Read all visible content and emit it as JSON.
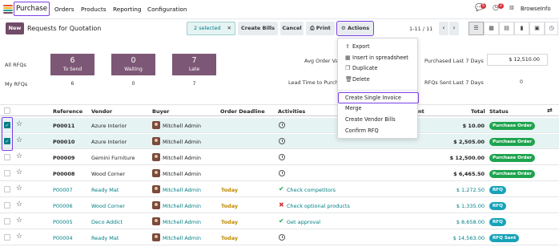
{
  "nav": {
    "app": "Purchase",
    "items": [
      "Orders",
      "Products",
      "Reporting",
      "Configuration"
    ],
    "chat_badge": "5",
    "activity_badge": "2",
    "company": "BrowseInfo"
  },
  "control": {
    "new_label": "New",
    "title": "Requests for Quotation",
    "selected_label": "2 selected",
    "clear_symbol": "✕",
    "create_bills": "Create Bills",
    "cancel": "Cancel",
    "print": "Print",
    "actions": "Actions",
    "pager": "1-11 / 11",
    "prev": "‹",
    "next": "›"
  },
  "dashboard": {
    "all_rfqs_label": "All RFQs",
    "my_rfqs_label": "My RFQs",
    "tiles": [
      {
        "value": "6",
        "label": "To Send"
      },
      {
        "value": "0",
        "label": "Waiting"
      },
      {
        "value": "7",
        "label": "Late"
      }
    ],
    "my_values": [
      "6",
      "0",
      "7"
    ],
    "avg_order_label": "Avg Order Va",
    "lead_time_label": "Lead Time to Purch",
    "purchased_label": "Purchased Last 7 Days",
    "purchased_value": "$ 12,510.00",
    "rfqs_sent_label": "RFQs Sent Last 7 Days",
    "rfqs_sent_value": "0"
  },
  "actions_menu": {
    "items": [
      "Export",
      "Insert in spreadsheet",
      "Duplicate",
      "Delete"
    ],
    "items2": [
      "Create Single Invoice",
      "Merge",
      "Create Vendor Bills",
      "Confirm RFQ"
    ]
  },
  "table": {
    "headers": {
      "reference": "Reference",
      "vendor": "Vendor",
      "buyer": "Buyer",
      "deadline": "Order Deadline",
      "activities": "Activities",
      "partial": "nt",
      "total": "Total",
      "status": "Status"
    },
    "rows": [
      {
        "ref": "P00011",
        "vendor": "Azure Interior",
        "buyer": "Mitchell Admin",
        "deadline": "",
        "activity": "",
        "activity_kind": "clock",
        "total": "$ 10.00",
        "status": "Purchase Order",
        "status_kind": "po",
        "selected": true,
        "style": "bold"
      },
      {
        "ref": "P00010",
        "vendor": "Azure Interior",
        "buyer": "Mitchell Admin",
        "deadline": "",
        "activity": "",
        "activity_kind": "clock",
        "total": "$ 2,505.00",
        "status": "Purchase Order",
        "status_kind": "po",
        "selected": true,
        "style": "bold"
      },
      {
        "ref": "P00009",
        "vendor": "Gemini Furniture",
        "buyer": "Mitchell Admin",
        "deadline": "",
        "activity": "",
        "activity_kind": "clock",
        "total": "$ 12,500.00",
        "status": "Purchase Order",
        "status_kind": "po",
        "selected": false,
        "style": "normal"
      },
      {
        "ref": "P00008",
        "vendor": "Wood Corner",
        "buyer": "Mitchell Admin",
        "deadline": "",
        "activity": "",
        "activity_kind": "clock",
        "total": "$ 6,465.50",
        "status": "Purchase Order",
        "status_kind": "po",
        "selected": false,
        "style": "normal"
      },
      {
        "ref": "P00007",
        "vendor": "Ready Mat",
        "buyer": "Mitchell Admin",
        "deadline": "Today",
        "activity": "Check competitors",
        "activity_kind": "check",
        "total": "$ 1,272.50",
        "status": "RFQ",
        "status_kind": "rfq",
        "selected": false,
        "style": "link"
      },
      {
        "ref": "P00006",
        "vendor": "Wood Corner",
        "buyer": "Mitchell Admin",
        "deadline": "Today",
        "activity": "Check optional products",
        "activity_kind": "cross",
        "total": "$ 1,335.00",
        "status": "RFQ",
        "status_kind": "rfq",
        "selected": false,
        "style": "link"
      },
      {
        "ref": "P00005",
        "vendor": "Deco Addict",
        "buyer": "Mitchell Admin",
        "deadline": "Today",
        "activity": "Get approval",
        "activity_kind": "check",
        "total": "$ 8,658.00",
        "status": "RFQ",
        "status_kind": "rfq",
        "selected": false,
        "style": "link"
      },
      {
        "ref": "P00004",
        "vendor": "Ready Mat",
        "buyer": "Mitchell Admin",
        "deadline": "Today",
        "activity": "",
        "activity_kind": "clock",
        "total": "$ 14,563.00",
        "status": "RFQ Sent",
        "status_kind": "rfq",
        "selected": false,
        "style": "link"
      }
    ]
  },
  "colors": {
    "brand": "#714b67",
    "tile": "#7d5876",
    "teal": "#017e84",
    "po_badge": "#1ea44e",
    "rfq_badge": "#17a2b8",
    "highlight": "#7b3fe4",
    "late": "#c08a00"
  }
}
